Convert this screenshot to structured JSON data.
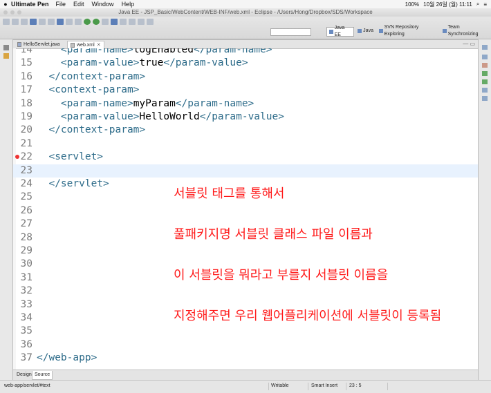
{
  "mac_menubar": {
    "app": "Ultimate Pen",
    "items": [
      "File",
      "Edit",
      "Window",
      "Help"
    ],
    "battery": "100%",
    "datetime": "10월 26일 (월)  11:11"
  },
  "window_title": "Java EE - JSP_Basic/WebContent/WEB-INF/web.xml - Eclipse - /Users/Hong/Dropbox/SDS/Workspace",
  "perspectives": [
    "Java EE",
    "Java",
    "SVN Repository Exploring",
    "Team Synchronizing"
  ],
  "editor_tabs": [
    {
      "label": "HelloServlet.java",
      "active": false
    },
    {
      "label": "web.xml",
      "active": true
    }
  ],
  "code_lines": [
    {
      "num": "14",
      "indent": "    ",
      "open": "<param-name>",
      "value": "logEnabled",
      "close": "</param-name>"
    },
    {
      "num": "15",
      "indent": "    ",
      "open": "<param-value>",
      "value": "true",
      "close": "</param-value>"
    },
    {
      "num": "16",
      "indent": "  ",
      "open": "</context-param>",
      "value": "",
      "close": ""
    },
    {
      "num": "17",
      "indent": "  ",
      "open": "<context-param>",
      "value": "",
      "close": ""
    },
    {
      "num": "18",
      "indent": "    ",
      "open": "<param-name>",
      "value": "myParam",
      "close": "</param-name>"
    },
    {
      "num": "19",
      "indent": "    ",
      "open": "<param-value>",
      "value": "HelloWorld",
      "close": "</param-value>"
    },
    {
      "num": "20",
      "indent": "  ",
      "open": "</context-param>",
      "value": "",
      "close": ""
    },
    {
      "num": "21",
      "indent": "",
      "open": "",
      "value": "",
      "close": ""
    },
    {
      "num": "22",
      "indent": "  ",
      "open": "<servlet>",
      "value": "",
      "close": ""
    },
    {
      "num": "23",
      "indent": "",
      "open": "",
      "value": "",
      "close": ""
    },
    {
      "num": "24",
      "indent": "  ",
      "open": "</servlet>",
      "value": "",
      "close": ""
    },
    {
      "num": "25",
      "indent": "",
      "open": "",
      "value": "",
      "close": ""
    },
    {
      "num": "26",
      "indent": "",
      "open": "",
      "value": "",
      "close": ""
    },
    {
      "num": "27",
      "indent": "",
      "open": "",
      "value": "",
      "close": ""
    },
    {
      "num": "28",
      "indent": "",
      "open": "",
      "value": "",
      "close": ""
    },
    {
      "num": "29",
      "indent": "",
      "open": "",
      "value": "",
      "close": ""
    },
    {
      "num": "30",
      "indent": "",
      "open": "",
      "value": "",
      "close": ""
    },
    {
      "num": "31",
      "indent": "",
      "open": "",
      "value": "",
      "close": ""
    },
    {
      "num": "32",
      "indent": "",
      "open": "",
      "value": "",
      "close": ""
    },
    {
      "num": "33",
      "indent": "",
      "open": "",
      "value": "",
      "close": ""
    },
    {
      "num": "34",
      "indent": "",
      "open": "",
      "value": "",
      "close": ""
    },
    {
      "num": "35",
      "indent": "",
      "open": "",
      "value": "",
      "close": ""
    },
    {
      "num": "36",
      "indent": "",
      "open": "",
      "value": "",
      "close": ""
    },
    {
      "num": "37",
      "indent": "",
      "open": "</web-app>",
      "value": "",
      "close": ""
    }
  ],
  "current_line": "23",
  "error_line": "22",
  "annotation_lines": [
    "서블릿 태그를 통해서",
    "풀패키지명 서블릿 클래스 파일 이름과",
    "이 서블릿을 뭐라고 부를지 서블릿 이름을",
    "지정해주면 우리 웹어플리케이션에 서블릿이 등록됨"
  ],
  "bottom_tabs": [
    "Design",
    "Source"
  ],
  "status": {
    "path": "web-app/servlet/#text",
    "mode": "Writable",
    "insert": "Smart Insert",
    "position": "23 : 5"
  },
  "colors": {
    "tag": "#2e6c8a",
    "annotation": "#ff1a1a",
    "current_line_bg": "#e8f2fe"
  }
}
